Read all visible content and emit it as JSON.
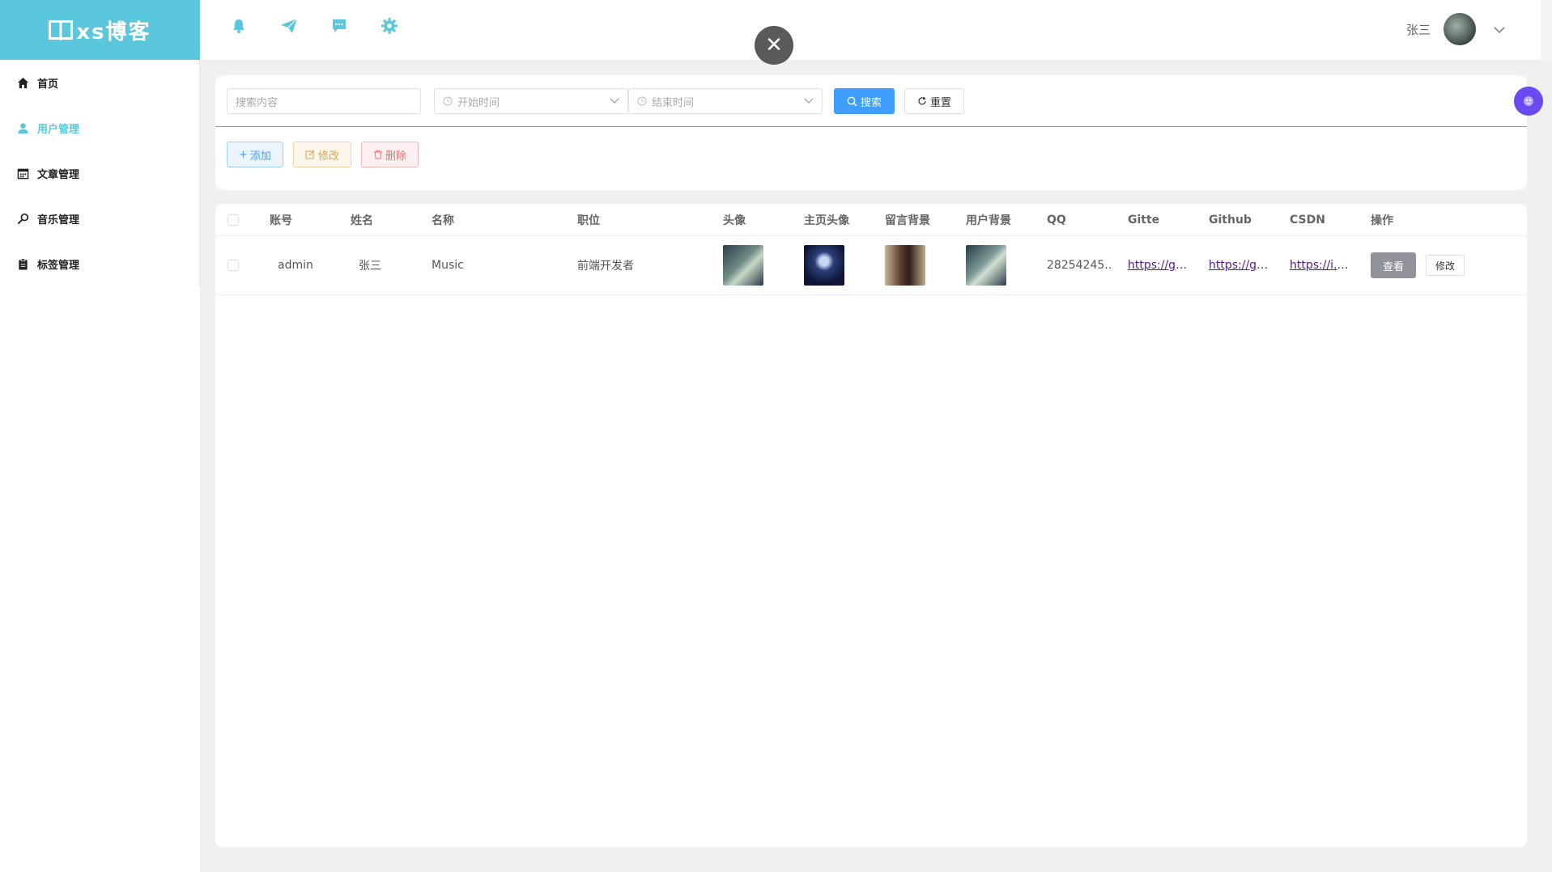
{
  "app": {
    "logo_text": "xs博客"
  },
  "sidebar": {
    "items": [
      {
        "label": "首页",
        "icon": "home-icon"
      },
      {
        "label": "用户管理",
        "icon": "user-icon"
      },
      {
        "label": "文章管理",
        "icon": "calendar-icon"
      },
      {
        "label": "音乐管理",
        "icon": "search-icon"
      },
      {
        "label": "标签管理",
        "icon": "clipboard-icon"
      }
    ],
    "active_index": 1
  },
  "header": {
    "icons": [
      "bell-icon",
      "send-icon",
      "chat-icon",
      "gear-icon"
    ],
    "user_name": "张三"
  },
  "filter": {
    "search_placeholder": "搜索内容",
    "start_placeholder": "开始时间",
    "end_placeholder": "结束时间",
    "search_label": "搜索",
    "reset_label": "重置"
  },
  "actions": {
    "add_label": "添加",
    "edit_label": "修改",
    "delete_label": "删除"
  },
  "table": {
    "columns": [
      "账号",
      "姓名",
      "名称",
      "职位",
      "头像",
      "主页头像",
      "留言背景",
      "用户背景",
      "QQ",
      "Gitte",
      "Github",
      "CSDN",
      "操作"
    ],
    "rows": [
      {
        "account": "admin",
        "name": "张三",
        "title": "Music",
        "position": "前端开发者",
        "qq": "28254245...",
        "gitte": "https://gi...",
        "github": "https://gi...",
        "csdn": "https://i.c...",
        "view_label": "查看",
        "edit_label": "修改"
      }
    ]
  },
  "colors": {
    "brand": "#5bc7dc",
    "primary": "#409eff",
    "warning": "#e6a23c",
    "danger": "#f56c6c",
    "info": "#909399"
  }
}
